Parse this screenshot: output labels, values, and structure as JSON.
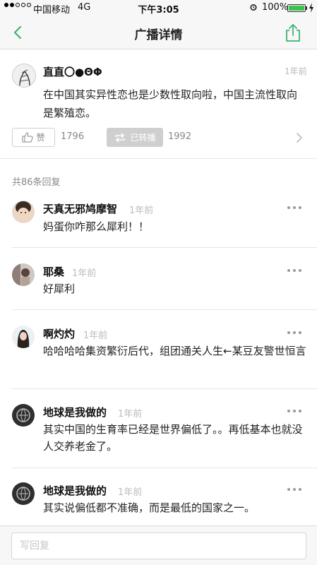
{
  "status_bar": {
    "carrier": "中国移动",
    "network": "4G",
    "time": "下午3:05",
    "battery_percent": "100%",
    "battery_level": 1.0,
    "signal_bars_filled": 2,
    "signal_bars_total": 5
  },
  "nav": {
    "title": "广播详情",
    "back_icon": "chevron-left-icon",
    "share_icon": "share-icon"
  },
  "colors": {
    "accent": "#3cb371",
    "muted": "#bbbbbb",
    "battery": "#3cc24d"
  },
  "post": {
    "author": "直直〇●ΘΦ",
    "time": "1年前",
    "text": "在中国其实异性恋也是少数性取向啦，中国主流性取向是繁殖恋。",
    "like_label": "赞",
    "like_count": "1796",
    "reshare_label": "已转播",
    "reshare_count": "1992"
  },
  "replies": {
    "count_label": "共86条回复",
    "items": [
      {
        "name": "天真无邪鸠摩智",
        "time": "1年前",
        "text": "妈蛋你咋那么犀利！！"
      },
      {
        "name": "耶桑",
        "time": "1年前",
        "text": "好犀利"
      },
      {
        "name": "啊灼灼",
        "time": "1年前",
        "text": "哈哈哈哈集资繁衍后代，组团通关人生←某豆友警世恒言"
      },
      {
        "name": "地球是我做的",
        "time": "1年前",
        "text": "其实中国的生育率已经是世界偏低了。。再低基本也就没人交养老金了。"
      },
      {
        "name": "地球是我做的",
        "time": "1年前",
        "text": "其实说偏低都不准确，而是最低的国家之一。"
      }
    ]
  },
  "reply_bar": {
    "placeholder": "写回复"
  }
}
